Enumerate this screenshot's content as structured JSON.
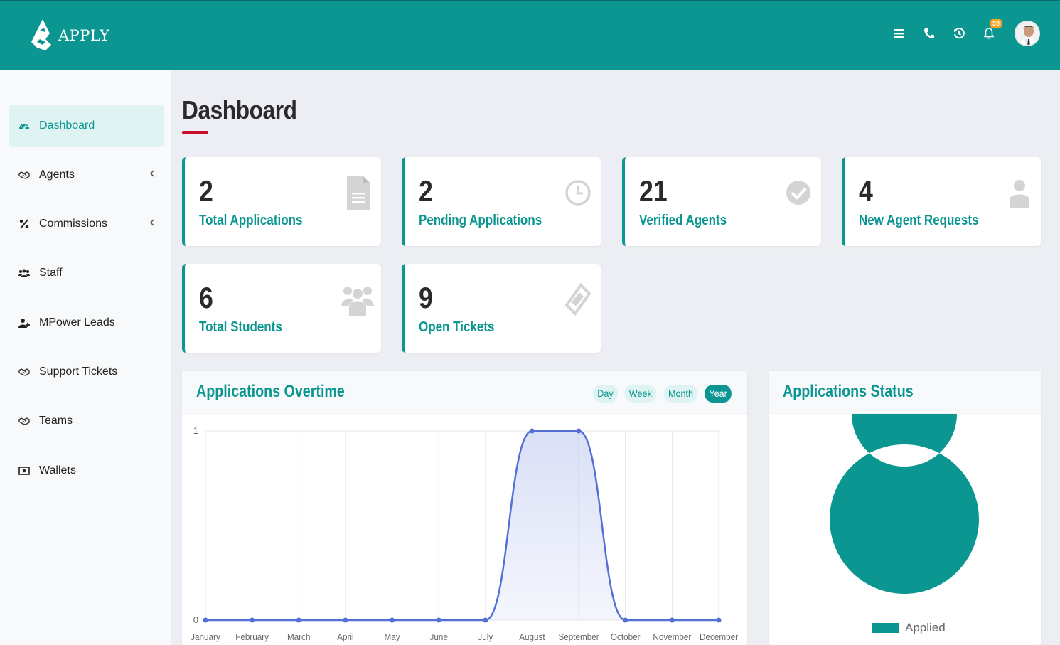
{
  "brand": {
    "name": "APPLY"
  },
  "header": {
    "notification_count": "59",
    "icons": [
      "menu-icon",
      "phone-icon",
      "history-icon",
      "bell-icon"
    ]
  },
  "sidebar": {
    "items": [
      {
        "label": "Dashboard",
        "icon": "dashboard-icon",
        "active": true
      },
      {
        "label": "Agents",
        "icon": "handshake-icon",
        "has_submenu": true
      },
      {
        "label": "Commissions",
        "icon": "percent-icon",
        "has_submenu": true
      },
      {
        "label": "Staff",
        "icon": "users-icon"
      },
      {
        "label": "MPower Leads",
        "icon": "user-plus-icon"
      },
      {
        "label": "Support Tickets",
        "icon": "handshake-icon"
      },
      {
        "label": "Teams",
        "icon": "handshake-icon"
      },
      {
        "label": "Wallets",
        "icon": "money-icon"
      }
    ]
  },
  "page": {
    "title": "Dashboard"
  },
  "stats": [
    {
      "value": "2",
      "label": "Total Applications",
      "icon": "file-icon"
    },
    {
      "value": "2",
      "label": "Pending Applications",
      "icon": "clock-icon"
    },
    {
      "value": "21",
      "label": "Verified Agents",
      "icon": "check-circle-icon"
    },
    {
      "value": "4",
      "label": "New Agent Requests",
      "icon": "user-icon"
    },
    {
      "value": "6",
      "label": "Total Students",
      "icon": "users-icon"
    },
    {
      "value": "9",
      "label": "Open Tickets",
      "icon": "ticket-icon"
    }
  ],
  "overtime_panel": {
    "title": "Applications Overtime",
    "ranges": [
      "Day",
      "Week",
      "Month",
      "Year"
    ],
    "active_range": "Year"
  },
  "status_panel": {
    "title": "Applications Status"
  },
  "colors": {
    "primary": "#0b9691",
    "line": "#5470d6",
    "accent_red": "#c8102e",
    "badge": "#f5a623"
  },
  "chart_data": [
    {
      "type": "line",
      "title": "Applications Overtime",
      "categories": [
        "January",
        "February",
        "March",
        "April",
        "May",
        "June",
        "July",
        "August",
        "September",
        "October",
        "November",
        "December"
      ],
      "series": [
        {
          "values": [
            0,
            0,
            0,
            0,
            0,
            0,
            0,
            1,
            1,
            0,
            0,
            0
          ]
        }
      ],
      "ylim": [
        0,
        1
      ],
      "yticks": [
        "0",
        "1"
      ],
      "fill": true,
      "grid": true
    },
    {
      "type": "pie",
      "title": "Applications Status",
      "donut": true,
      "labels": [
        "Applied"
      ],
      "values": [
        2
      ],
      "legend": "bottom"
    }
  ]
}
